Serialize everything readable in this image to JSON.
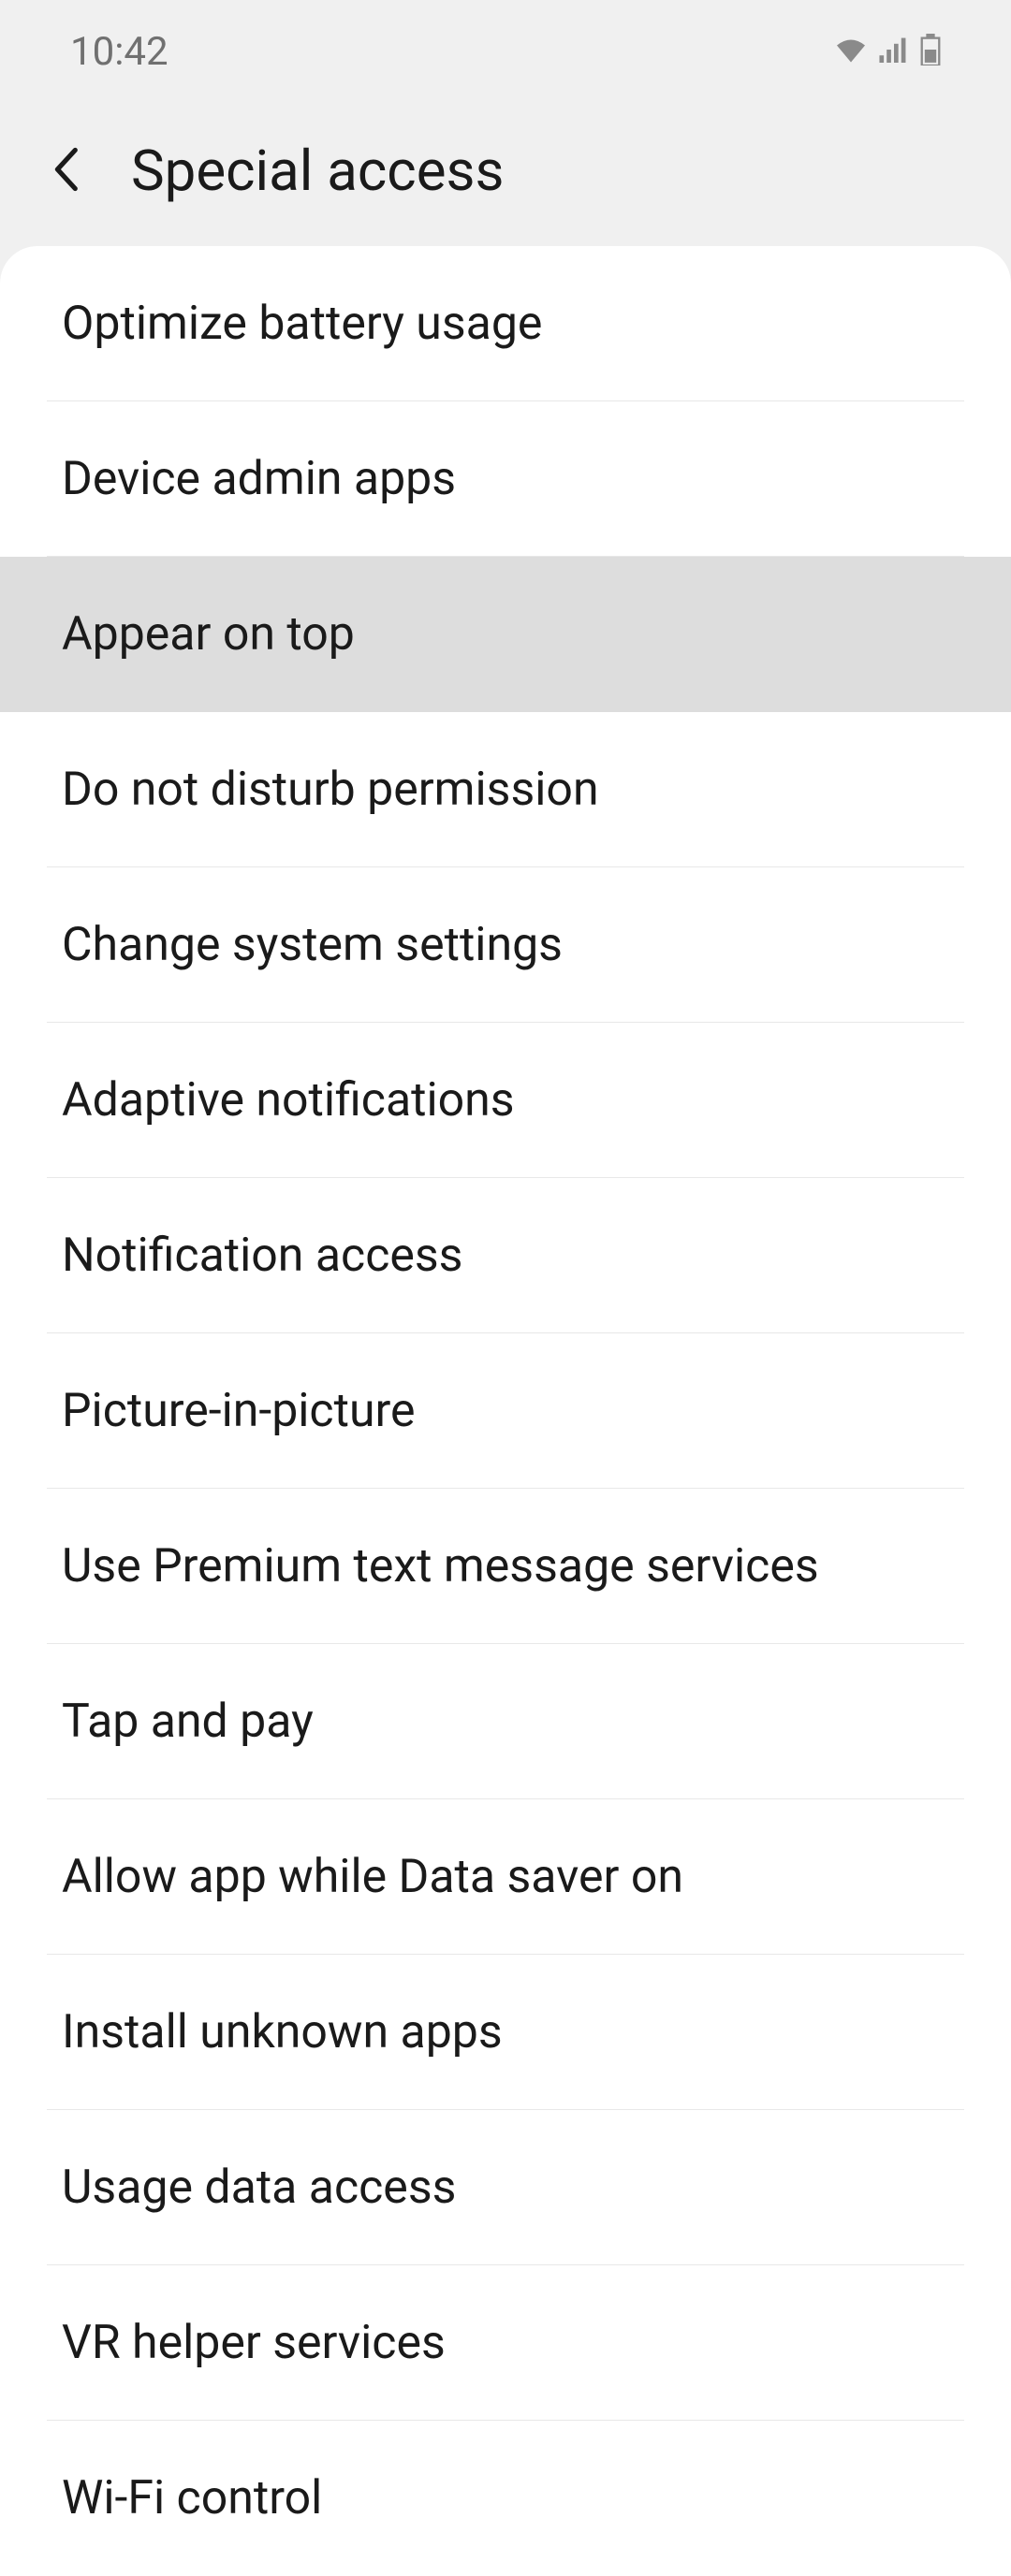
{
  "status_bar": {
    "time": "10:42"
  },
  "header": {
    "title": "Special access"
  },
  "list": {
    "items": [
      {
        "label": "Optimize battery usage",
        "highlighted": false
      },
      {
        "label": "Device admin apps",
        "highlighted": false
      },
      {
        "label": "Appear on top",
        "highlighted": true
      },
      {
        "label": "Do not disturb permission",
        "highlighted": false
      },
      {
        "label": "Change system settings",
        "highlighted": false
      },
      {
        "label": "Adaptive notifications",
        "highlighted": false
      },
      {
        "label": "Notification access",
        "highlighted": false
      },
      {
        "label": "Picture-in-picture",
        "highlighted": false
      },
      {
        "label": "Use Premium text message services",
        "highlighted": false
      },
      {
        "label": "Tap and pay",
        "highlighted": false
      },
      {
        "label": "Allow app while Data saver on",
        "highlighted": false
      },
      {
        "label": "Install unknown apps",
        "highlighted": false
      },
      {
        "label": "Usage data access",
        "highlighted": false
      },
      {
        "label": "VR helper services",
        "highlighted": false
      },
      {
        "label": "Wi-Fi control",
        "highlighted": false
      }
    ]
  }
}
